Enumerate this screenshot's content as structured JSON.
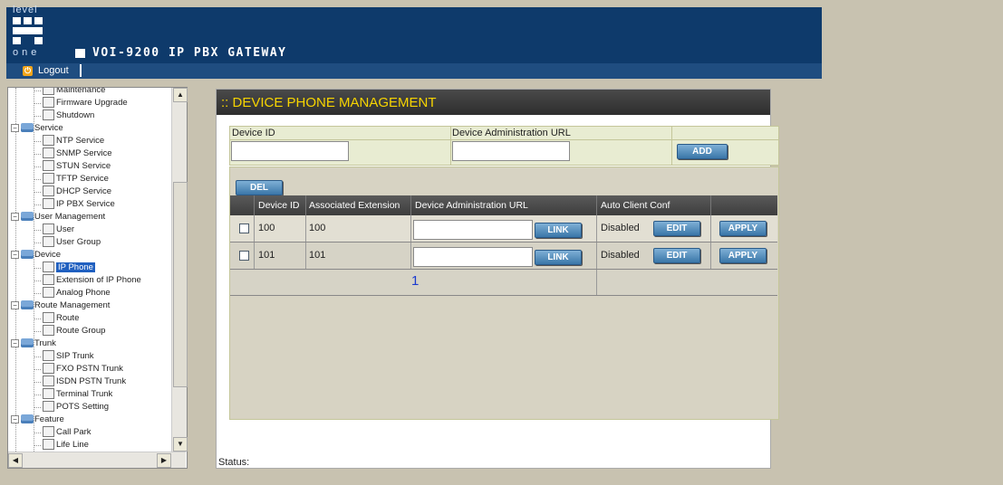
{
  "header": {
    "logo_top": "level",
    "logo_bottom": "one",
    "product": "VOI-9200 IP PBX GATEWAY",
    "logout": "Logout"
  },
  "tree": {
    "items": [
      {
        "label": "Maintenance",
        "type": "leaf"
      },
      {
        "label": "Firmware Upgrade",
        "type": "leaf"
      },
      {
        "label": "Shutdown",
        "type": "leaf"
      },
      {
        "label": "Service",
        "type": "folder"
      },
      {
        "label": "NTP Service",
        "type": "leaf"
      },
      {
        "label": "SNMP Service",
        "type": "leaf"
      },
      {
        "label": "STUN Service",
        "type": "leaf"
      },
      {
        "label": "TFTP Service",
        "type": "leaf"
      },
      {
        "label": "DHCP Service",
        "type": "leaf"
      },
      {
        "label": "IP PBX Service",
        "type": "leaf"
      },
      {
        "label": "User Management",
        "type": "folder"
      },
      {
        "label": "User",
        "type": "leaf"
      },
      {
        "label": "User Group",
        "type": "leaf"
      },
      {
        "label": "Device",
        "type": "folder"
      },
      {
        "label": "IP Phone",
        "type": "leaf",
        "selected": true
      },
      {
        "label": "Extension of IP Phone",
        "type": "leaf"
      },
      {
        "label": "Analog Phone",
        "type": "leaf"
      },
      {
        "label": "Route Management",
        "type": "folder"
      },
      {
        "label": "Route",
        "type": "leaf"
      },
      {
        "label": "Route Group",
        "type": "leaf"
      },
      {
        "label": "Trunk",
        "type": "folder"
      },
      {
        "label": "SIP Trunk",
        "type": "leaf"
      },
      {
        "label": "FXO PSTN Trunk",
        "type": "leaf"
      },
      {
        "label": "ISDN PSTN Trunk",
        "type": "leaf"
      },
      {
        "label": "Terminal Trunk",
        "type": "leaf"
      },
      {
        "label": "POTS Setting",
        "type": "leaf"
      },
      {
        "label": "Feature",
        "type": "folder"
      },
      {
        "label": "Call Park",
        "type": "leaf"
      },
      {
        "label": "Life Line",
        "type": "leaf"
      }
    ]
  },
  "main": {
    "title": ":: DEVICE PHONE MANAGEMENT",
    "add_form": {
      "device_id_label": "Device ID",
      "url_label": "Device Administration URL",
      "device_id_value": "",
      "url_value": "",
      "add_button": "ADD"
    },
    "del_button": "DEL",
    "columns": [
      "Device ID",
      "Associated Extension",
      "Device Administration URL",
      "Auto Client Conf"
    ],
    "rows": [
      {
        "device_id": "100",
        "extension": "100",
        "url": "",
        "auto_conf": "Disabled"
      },
      {
        "device_id": "101",
        "extension": "101",
        "url": "",
        "auto_conf": "Disabled"
      }
    ],
    "link_button": "LINK",
    "edit_button": "EDIT",
    "apply_button": "APPLY",
    "page": "1"
  },
  "status": "Status:"
}
